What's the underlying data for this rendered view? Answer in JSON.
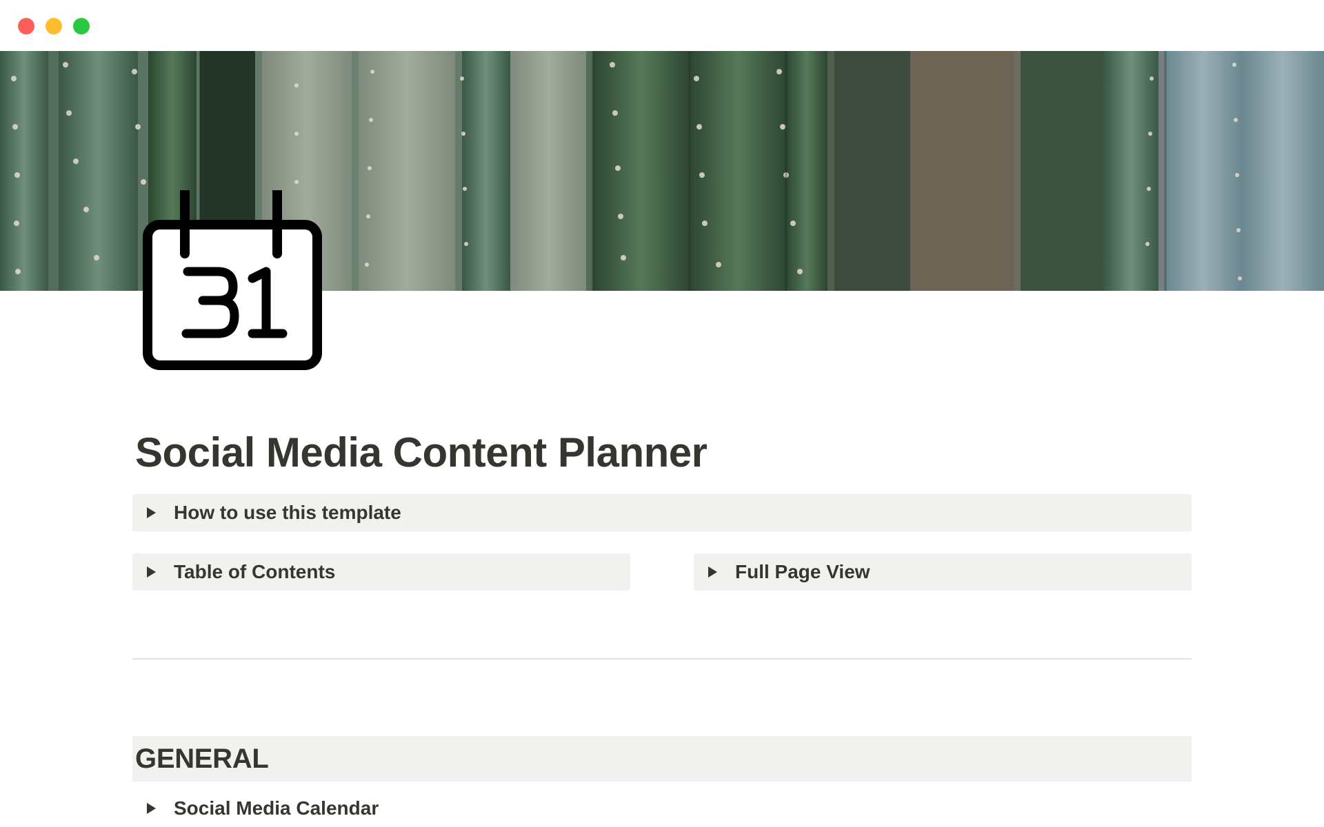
{
  "window": {
    "controls": {
      "close_color": "#fe5f57",
      "minimize_color": "#febc2e",
      "zoom_color": "#28c840"
    }
  },
  "cover": {
    "image": "cactus-photo"
  },
  "page": {
    "icon": "calendar-31-icon",
    "title": "Social Media Content Planner"
  },
  "toggles": {
    "how_to": "How to use this template",
    "table_of_contents": "Table of Contents",
    "full_page_view": "Full Page View"
  },
  "sections": [
    {
      "heading": "GENERAL",
      "items": [
        {
          "label": "Social Media Calendar"
        }
      ]
    }
  ],
  "colors": {
    "text": "#37352f",
    "toggle_bg": "#f1f1ef",
    "divider": "#e3e2e0"
  }
}
